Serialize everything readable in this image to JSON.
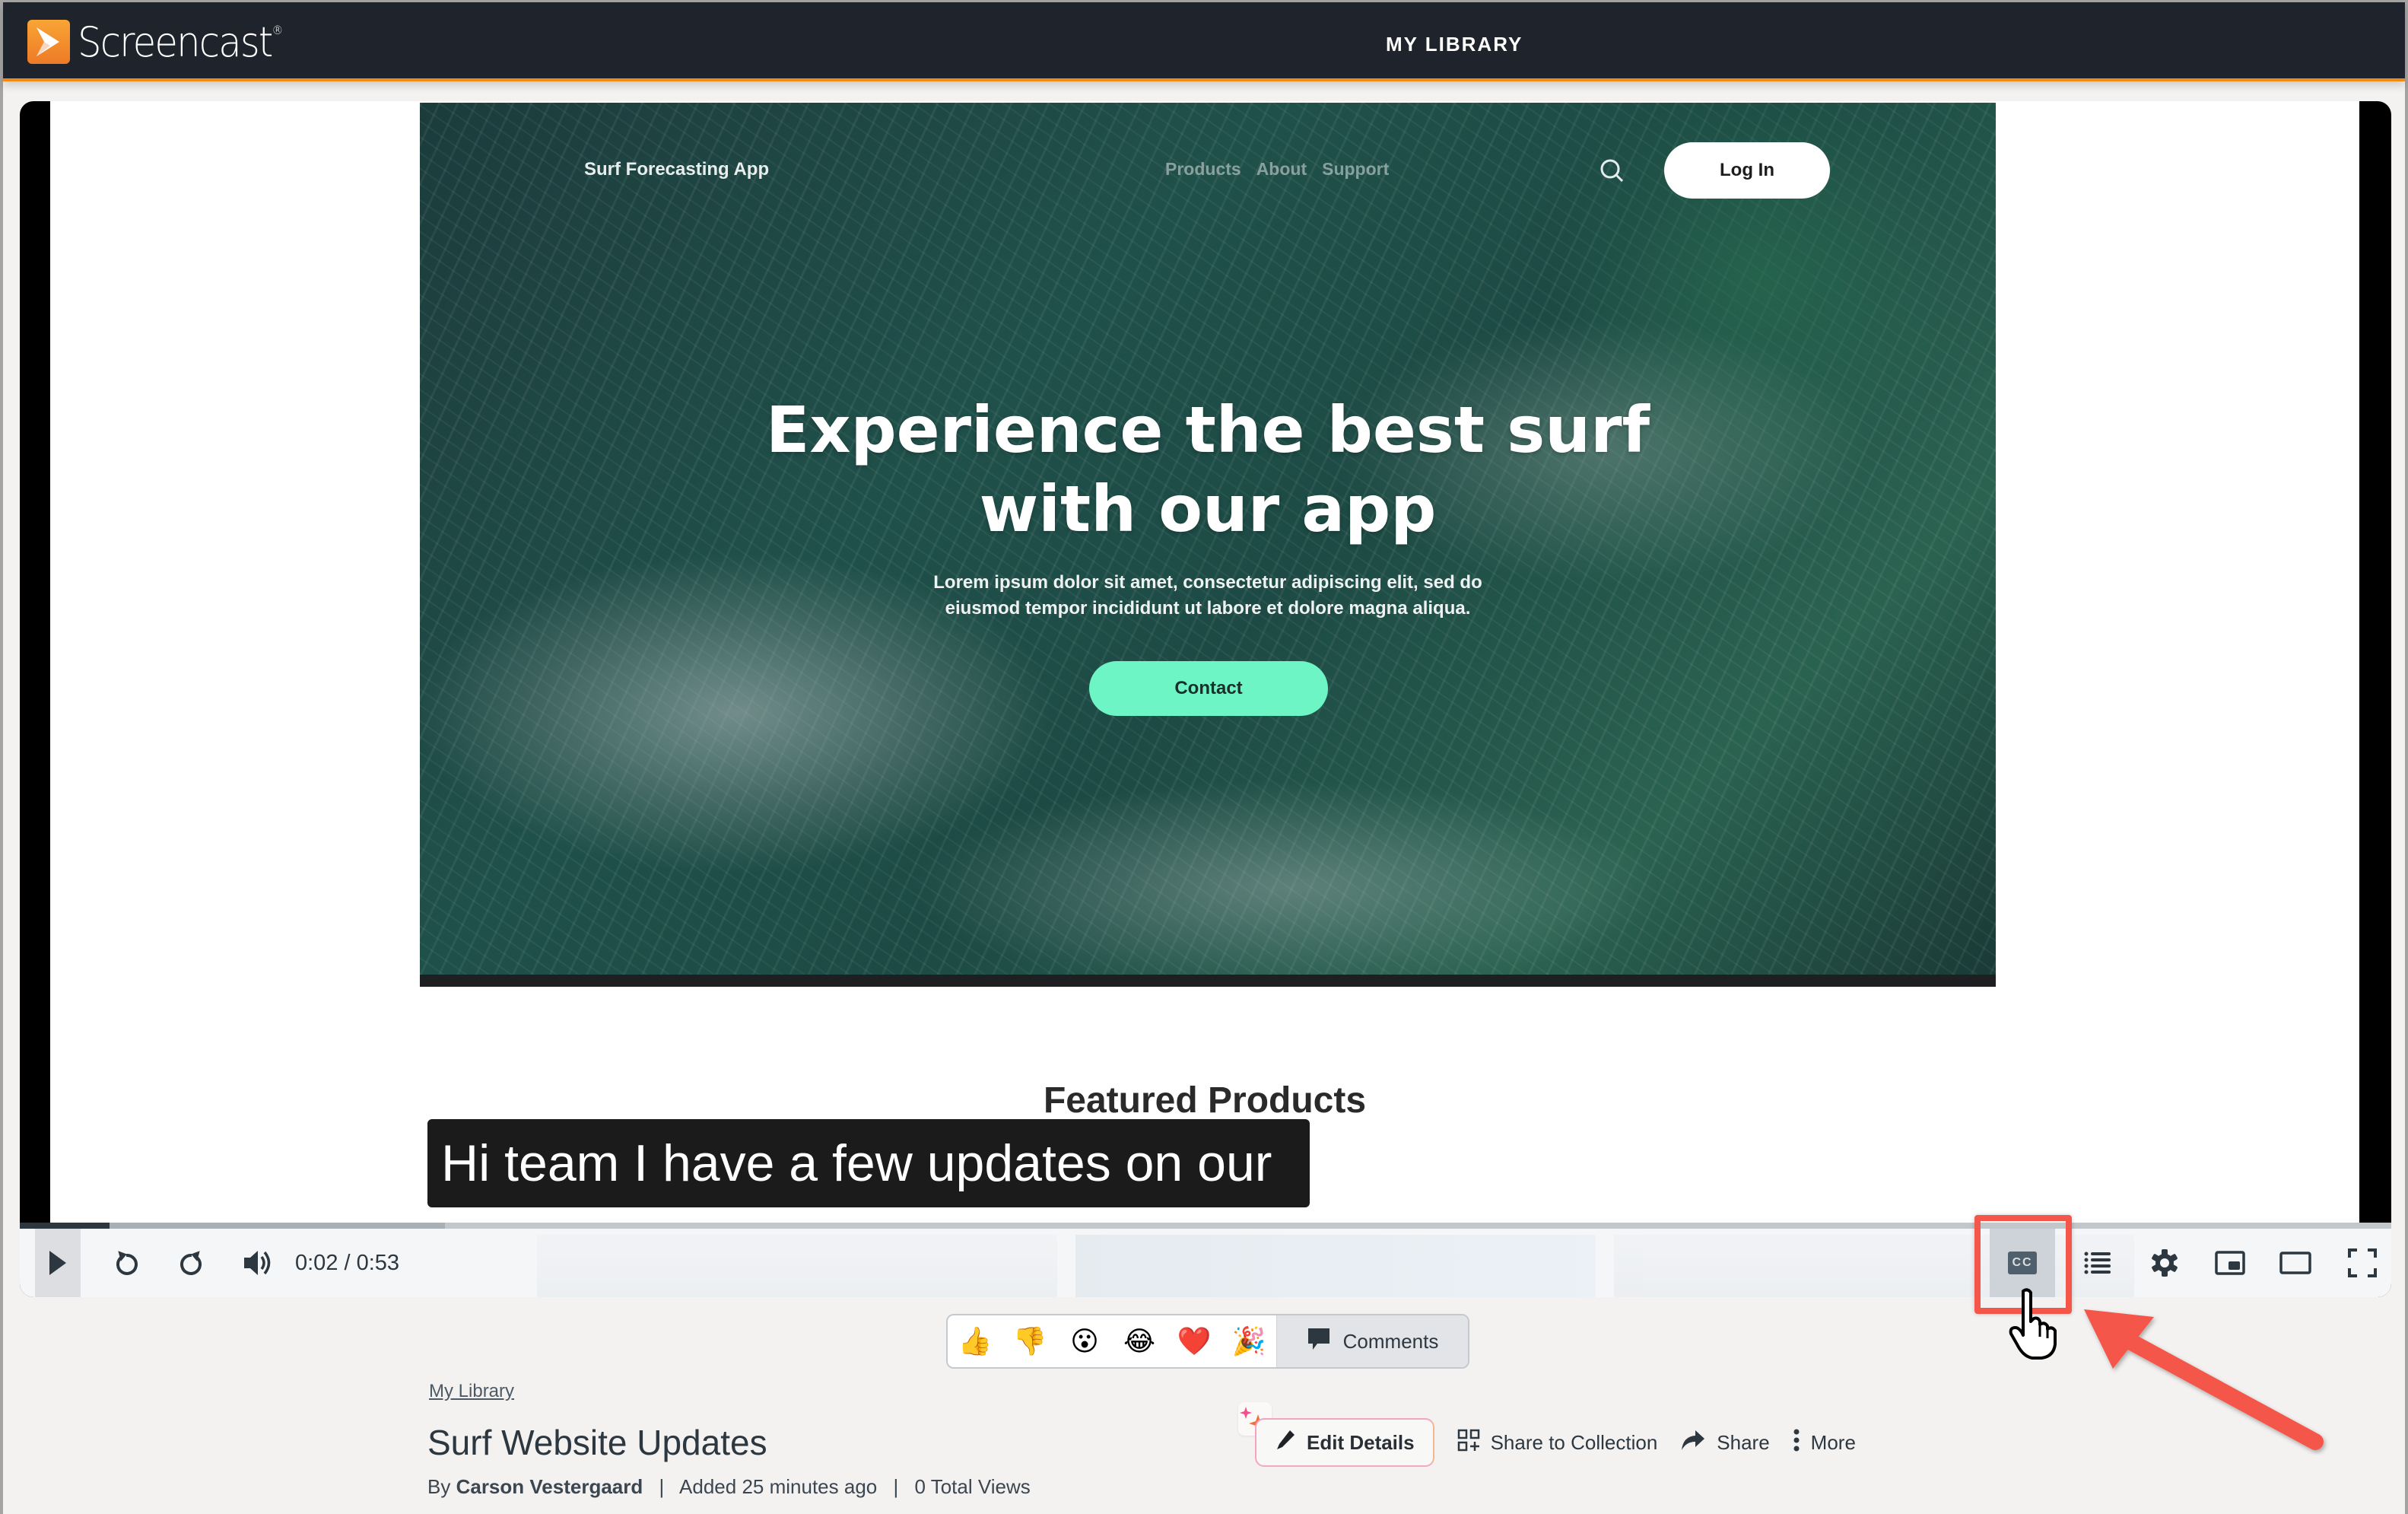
{
  "app": {
    "brand": "Screencast",
    "brand_mark": "®",
    "nav_title": "MY LIBRARY",
    "accent_color": "#f08a14",
    "header_bg": "#1f232b"
  },
  "video_frame": {
    "site_brand": "Surf Forecasting App",
    "site_nav": [
      "Products",
      "About",
      "Support"
    ],
    "login_label": "Log In",
    "hero_title_line1": "Experience the best surf",
    "hero_title_line2": "with our app",
    "hero_sub_line1": "Lorem ipsum dolor sit amet, consectetur adipiscing elit, sed do",
    "hero_sub_line2": "eiusmod tempor incididunt ut labore et dolore magna aliqua.",
    "contact_label": "Contact",
    "featured_heading": "Featured Products"
  },
  "caption": {
    "text": "Hi team I have a few updates on our"
  },
  "player": {
    "current_time": "0:02",
    "duration": "0:53",
    "time_display": "0:02 / 0:53",
    "progress_fraction": 0.0377,
    "buffer_fraction": 0.064,
    "controls": {
      "play": "play-icon",
      "rewind": "rewind-icon",
      "forward": "forward-icon",
      "volume": "volume-icon",
      "captions": "closed-captions-icon",
      "chapters": "list-icon",
      "settings": "gear-icon",
      "pip": "picture-in-picture-icon",
      "theater": "theater-mode-icon",
      "fullscreen": "fullscreen-icon"
    },
    "cc_label": "CC",
    "captions_active": true
  },
  "reactions": {
    "items": [
      {
        "name": "thumbs-up",
        "glyph": "👍"
      },
      {
        "name": "thumbs-down",
        "glyph": "👎"
      },
      {
        "name": "surprised",
        "glyph": "😮"
      },
      {
        "name": "laughing",
        "glyph": "😂"
      },
      {
        "name": "heart",
        "glyph": "❤️"
      },
      {
        "name": "party",
        "glyph": "🎉"
      }
    ],
    "comments_label": "Comments"
  },
  "details": {
    "breadcrumb": "My Library",
    "title": "Surf Website Updates",
    "by_label": "By",
    "author": "Carson Vestergaard",
    "added": "Added 25 minutes ago",
    "views": "0 Total Views",
    "separator": "|"
  },
  "actions": {
    "edit": "Edit Details",
    "share_collection": "Share to Collection",
    "share": "Share",
    "more": "More"
  },
  "annotation": {
    "highlight_color": "#f4564a",
    "target": "closed-captions-button"
  }
}
